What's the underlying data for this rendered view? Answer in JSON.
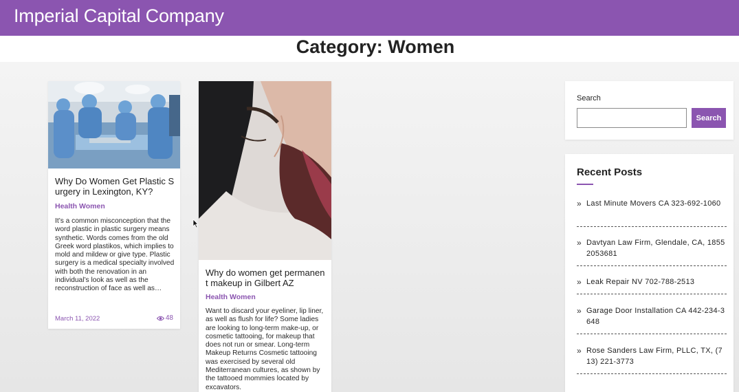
{
  "site": {
    "title": "Imperial Capital Company"
  },
  "category": {
    "title": "Category: Women"
  },
  "posts": [
    {
      "title": "Why Do Women Get Plastic Surgery in Lexington, KY?",
      "category": "Health Women",
      "excerpt": "It’s a common misconception that the word plastic in plastic surgery means synthetic. Words comes from the old Greek word plastikos, which implies to mold and mildew or give type. Plastic surgery is a medical specialty involved with both the renovation in an individual’s look as well as the reconstruction of face as well as…",
      "date": "March 11, 2022",
      "views": "48",
      "image": "surgery-team-photo"
    },
    {
      "title": "Why do women get permanent makeup in Gilbert AZ",
      "category": "Health Women",
      "excerpt": "Want to discard your eyeliner, lip liner, as well as flush for life? Some ladies are looking to long-term make-up, or cosmetic tattooing, for makeup that does not run or smear. Long-term Makeup Returns Cosmetic tattooing was exercised by several old Mediterranean cultures, as shown by the tattooed mommies located by excavators.",
      "image": "eyebrow-makeup-photo"
    }
  ],
  "sidebar": {
    "search": {
      "label": "Search",
      "placeholder": "",
      "button": "Search"
    },
    "recent": {
      "title": "Recent Posts",
      "items": [
        "Last Minute Movers CA 323-692-1060",
        "Davtyan Law Firm, Glendale, CA, 18552053681",
        "Leak Repair NV 702-788-2513",
        "Garage Door Installation CA 442-234-3648",
        "Rose Sanders Law Firm, PLLC, TX, (713) 221-3773"
      ]
    }
  },
  "colors": {
    "accent": "#8b55b0",
    "header": "#8b55b0"
  }
}
